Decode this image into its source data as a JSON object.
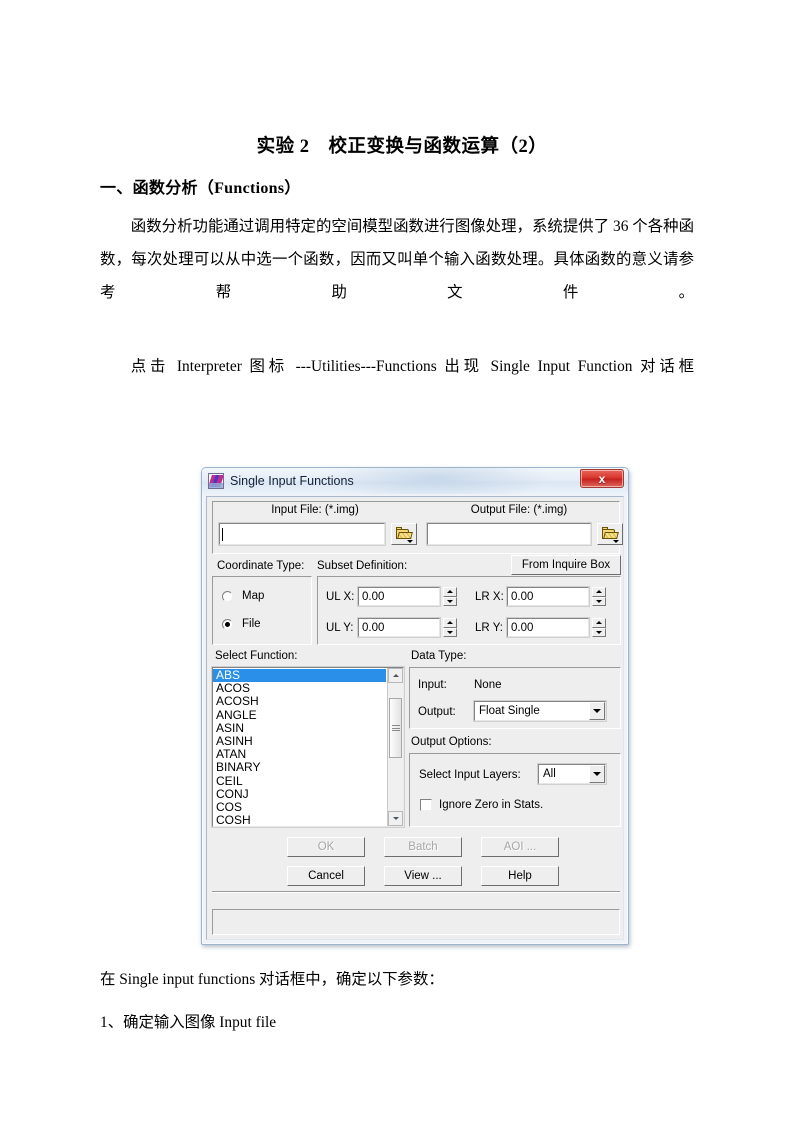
{
  "document": {
    "title": "实验 2　校正变换与函数运算（2）",
    "section_heading": "一、函数分析（Functions）",
    "paragraph_1": "函数分析功能通过调用特定的空间模型函数进行图像处理，系统提供了 36 个各种函数，每次处理可以从中选一个函数，因而又叫单个输入函数处理。具体函数的意义请参考帮助文件。",
    "paragraph_2": "点击 Interpreter 图标 ---Utilities---Functions 出现 Single Input Function 对话框",
    "paragraph_3": "在 Single input functions 对话框中，确定以下参数：",
    "paragraph_4": "1、确定输入图像 Input file"
  },
  "dialog": {
    "title": "Single Input Functions",
    "app_icon": "eardas-imagine-icon",
    "close_label": "✕",
    "close_glyph": "x",
    "file_section": {
      "input_label": "Input File: (*.img)",
      "output_label": "Output File: (*.img)",
      "input_value": "",
      "output_value": "",
      "input_placeholder": "",
      "output_placeholder": "",
      "browse_icon": "open-folder-icon"
    },
    "coordinate": {
      "label": "Coordinate Type:",
      "options": [
        "Map",
        "File"
      ],
      "selected": "File"
    },
    "subset": {
      "label": "Subset Definition:",
      "from_inquire_box_label": "From Inquire Box",
      "fields": [
        {
          "label": "UL X:",
          "value": "0.00"
        },
        {
          "label": "LR X:",
          "value": "0.00"
        },
        {
          "label": "UL Y:",
          "value": "0.00"
        },
        {
          "label": "LR Y:",
          "value": "0.00"
        }
      ]
    },
    "select_function": {
      "label": "Select Function:",
      "selected": "ABS",
      "items": [
        "ABS",
        "ACOS",
        "ACOSH",
        "ANGLE",
        "ASIN",
        "ASINH",
        "ATAN",
        "BINARY",
        "CEIL",
        "CONJ",
        "COS",
        "COSH"
      ]
    },
    "data_type": {
      "label": "Data Type:",
      "input_label": "Input:",
      "input_value": "None",
      "output_label": "Output:",
      "output_value": "Float Single"
    },
    "output_options": {
      "label": "Output Options:",
      "select_input_layers_label": "Select Input Layers:",
      "select_input_layers_value": "All",
      "ignore_zero_label": "Ignore Zero in Stats.",
      "ignore_zero_checked": false
    },
    "buttons": {
      "ok": "OK",
      "batch": "Batch",
      "aoi": "AOI ...",
      "cancel": "Cancel",
      "view": "View ...",
      "help": "Help"
    },
    "status_text": "",
    "colors": {
      "titlebar": "#e6edf6",
      "close_button": "#d8332a",
      "selection": "#2a8fe8",
      "face": "#eeeeee",
      "border": "#9cb5cd"
    }
  }
}
